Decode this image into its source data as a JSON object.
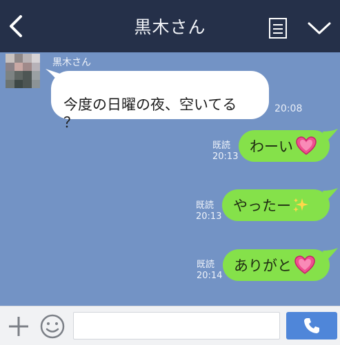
{
  "header": {
    "title": "黒木さん",
    "back_icon": "chevron-left-icon",
    "notes_icon": "note-list-icon",
    "menu_icon": "chevron-down-icon"
  },
  "messages": [
    {
      "direction": "incoming",
      "sender": "黒木さん",
      "text": "今度の日曜の夜、空いてる\n？",
      "time": "20:08"
    },
    {
      "direction": "outgoing",
      "text": "わーい",
      "emoji": "heart",
      "read_label": "既読",
      "time": "20:13"
    },
    {
      "direction": "outgoing",
      "text": "やったー",
      "emoji": "sparkles",
      "read_label": "既読",
      "time": "20:13"
    },
    {
      "direction": "outgoing",
      "text": "ありがと",
      "emoji": "heart",
      "read_label": "既読",
      "time": "20:14"
    }
  ],
  "footer": {
    "plus_icon": "plus-icon",
    "sticker_icon": "smiley-icon",
    "input_value": "",
    "call_icon": "phone-icon"
  },
  "colors": {
    "header_bg": "#253049",
    "chat_bg": "#7393c5",
    "outgoing_bubble": "#85e14a",
    "incoming_bubble": "#ffffff",
    "call_button": "#4f86d9"
  }
}
